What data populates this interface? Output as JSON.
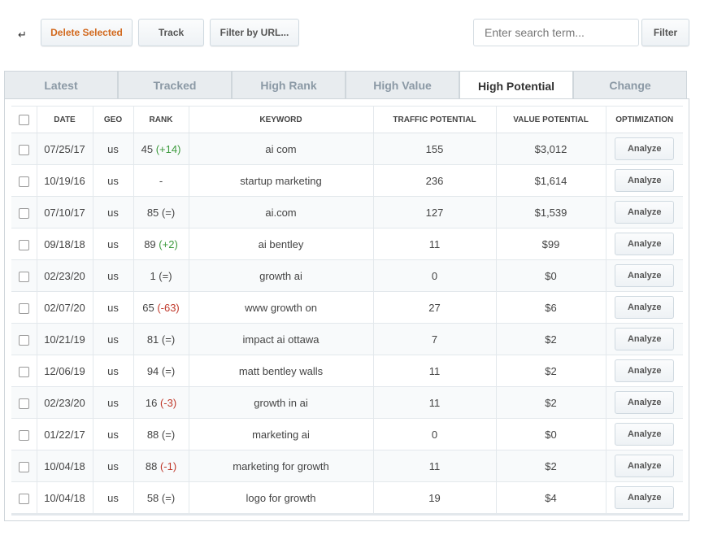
{
  "toolbar": {
    "delete_label": "Delete Selected",
    "track_label": "Track",
    "filter_url_label": "Filter by URL...",
    "search_placeholder": "Enter search term...",
    "filter_label": "Filter",
    "sort_icon": "sort-arrow-icon"
  },
  "tabs": [
    {
      "label": "Latest",
      "active": false
    },
    {
      "label": "Tracked",
      "active": false
    },
    {
      "label": "High Rank",
      "active": false
    },
    {
      "label": "High Value",
      "active": false
    },
    {
      "label": "High Potential",
      "active": true
    },
    {
      "label": "Change",
      "active": false
    }
  ],
  "table": {
    "columns": [
      "DATE",
      "GEO",
      "RANK",
      "KEYWORD",
      "TRAFFIC POTENTIAL",
      "VALUE POTENTIAL",
      "OPTIMIZATION"
    ],
    "action_label": "Analyze",
    "rows": [
      {
        "date": "07/25/17",
        "geo": "us",
        "rank": "45",
        "change": "(+14)",
        "dir": "up",
        "keyword": "ai com",
        "traffic": "155",
        "value": "$3,012"
      },
      {
        "date": "10/19/16",
        "geo": "us",
        "rank": "-",
        "change": "",
        "dir": "none",
        "keyword": "startup marketing",
        "traffic": "236",
        "value": "$1,614"
      },
      {
        "date": "07/10/17",
        "geo": "us",
        "rank": "85",
        "change": "(=)",
        "dir": "none",
        "keyword": "ai.com",
        "traffic": "127",
        "value": "$1,539"
      },
      {
        "date": "09/18/18",
        "geo": "us",
        "rank": "89",
        "change": "(+2)",
        "dir": "up",
        "keyword": "ai bentley",
        "traffic": "11",
        "value": "$99"
      },
      {
        "date": "02/23/20",
        "geo": "us",
        "rank": "1",
        "change": "(=)",
        "dir": "none",
        "keyword": "growth ai",
        "traffic": "0",
        "value": "$0"
      },
      {
        "date": "02/07/20",
        "geo": "us",
        "rank": "65",
        "change": "(-63)",
        "dir": "down",
        "keyword": "www growth on",
        "traffic": "27",
        "value": "$6"
      },
      {
        "date": "10/21/19",
        "geo": "us",
        "rank": "81",
        "change": "(=)",
        "dir": "none",
        "keyword": "impact ai ottawa",
        "traffic": "7",
        "value": "$2"
      },
      {
        "date": "12/06/19",
        "geo": "us",
        "rank": "94",
        "change": "(=)",
        "dir": "none",
        "keyword": "matt bentley walls",
        "traffic": "11",
        "value": "$2"
      },
      {
        "date": "02/23/20",
        "geo": "us",
        "rank": "16",
        "change": "(-3)",
        "dir": "down",
        "keyword": "growth in ai",
        "traffic": "11",
        "value": "$2"
      },
      {
        "date": "01/22/17",
        "geo": "us",
        "rank": "88",
        "change": "(=)",
        "dir": "none",
        "keyword": "marketing ai",
        "traffic": "0",
        "value": "$0"
      },
      {
        "date": "10/04/18",
        "geo": "us",
        "rank": "88",
        "change": "(-1)",
        "dir": "down",
        "keyword": "marketing for growth",
        "traffic": "11",
        "value": "$2"
      },
      {
        "date": "10/04/18",
        "geo": "us",
        "rank": "58",
        "change": "(=)",
        "dir": "none",
        "keyword": "logo for growth",
        "traffic": "19",
        "value": "$4"
      }
    ]
  },
  "colors": {
    "delete_text": "#d2691e",
    "change_up": "#3c9a3c",
    "change_down": "#c0392b"
  }
}
